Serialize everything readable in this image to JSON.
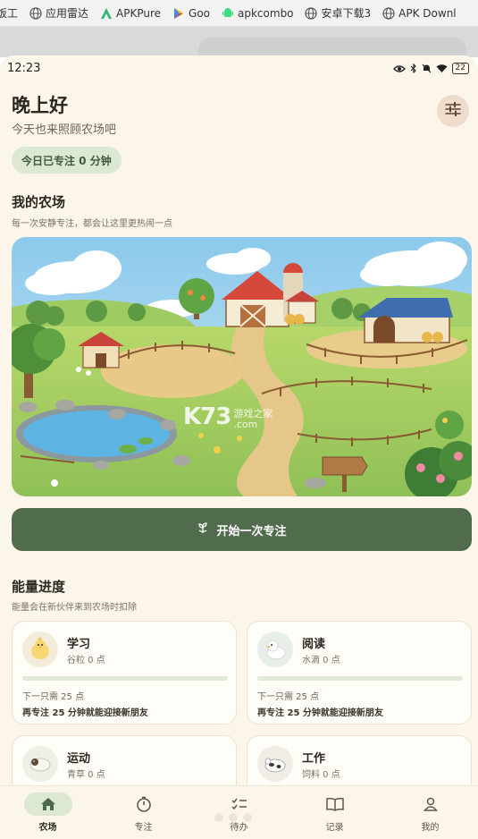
{
  "browser": {
    "bookmarks": [
      {
        "label": "饭工",
        "icon": "globe-icon"
      },
      {
        "label": "应用雷达",
        "icon": "globe-icon"
      },
      {
        "label": "APKPure",
        "icon": "apkpure-icon"
      },
      {
        "label": "Goo",
        "icon": "play-store-icon"
      },
      {
        "label": "apkcombo",
        "icon": "android-icon"
      },
      {
        "label": "安卓下载3",
        "icon": "globe-icon"
      },
      {
        "label": "APK Downl",
        "icon": "globe-icon"
      }
    ]
  },
  "status_bar": {
    "time": "12:23",
    "battery": "22"
  },
  "header": {
    "greeting": "晚上好",
    "subtitle": "今天也来照顾农场吧",
    "focus_today": "今日已专注 0 分钟"
  },
  "farm": {
    "title": "我的农场",
    "subtitle": "每一次安静专注，都会让这里更热闹一点",
    "watermark_main": "K73",
    "watermark_sub": "游戏之家",
    "watermark_url": ".com"
  },
  "start_button": {
    "label": "开始一次专注"
  },
  "energy": {
    "title": "能量进度",
    "subtitle": "能量会在新伙伴来到农场时扣除",
    "cards": [
      {
        "name": "学习",
        "resource": "谷粒 0 点",
        "need": "下一只需 25 点",
        "hint": "再专注 25 分钟就能迎接新朋友",
        "progress": 0,
        "icon": "chick-icon"
      },
      {
        "name": "阅读",
        "resource": "水滴 0 点",
        "need": "下一只需 25 点",
        "hint": "再专注 25 分钟就能迎接新朋友",
        "progress": 0,
        "icon": "duck-icon"
      },
      {
        "name": "运动",
        "resource": "青草 0 点",
        "icon": "sheep-icon"
      },
      {
        "name": "工作",
        "resource": "饲料 0 点",
        "icon": "cow-icon"
      }
    ]
  },
  "tabs": [
    {
      "label": "农场",
      "icon": "home-icon",
      "active": true
    },
    {
      "label": "专注",
      "icon": "timer-icon",
      "active": false
    },
    {
      "label": "待办",
      "icon": "checklist-icon",
      "active": false
    },
    {
      "label": "记录",
      "icon": "book-icon",
      "active": false
    },
    {
      "label": "我的",
      "icon": "profile-icon",
      "active": false
    }
  ],
  "colors": {
    "background": "#fbf6e9",
    "primary": "#516b4d",
    "chip": "#dde8d2",
    "settings": "#efdccc"
  }
}
